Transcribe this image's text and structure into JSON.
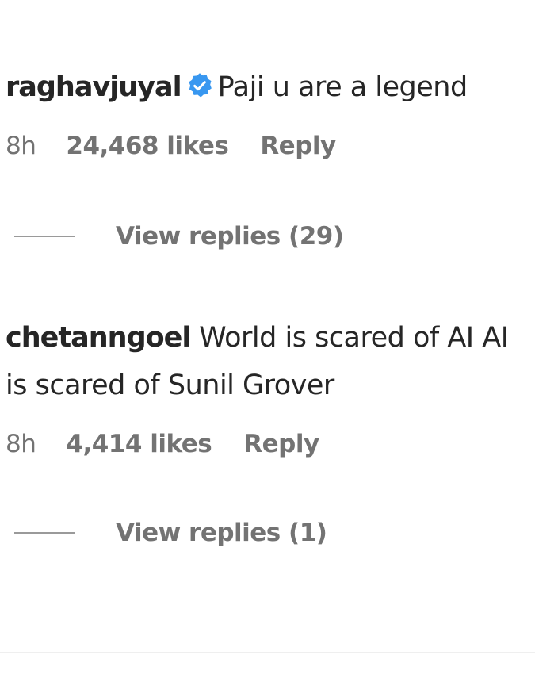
{
  "comments": [
    {
      "username": "raghavjuyal",
      "verified": true,
      "text": "Paji u are a legend",
      "time": "8h",
      "likes": "24,468 likes",
      "reply_label": "Reply",
      "view_replies": "View replies (29)"
    },
    {
      "username": "chetanngoel",
      "verified": false,
      "text": "World is scared of AI AI is scared of Sunil Grover",
      "time": "8h",
      "likes": "4,414 likes",
      "reply_label": "Reply",
      "view_replies": "View replies (1)"
    }
  ],
  "colors": {
    "text": "#262626",
    "secondary": "#737373",
    "verified_badge": "#3897f0"
  },
  "icons": {
    "verified": "verified-badge-icon"
  }
}
